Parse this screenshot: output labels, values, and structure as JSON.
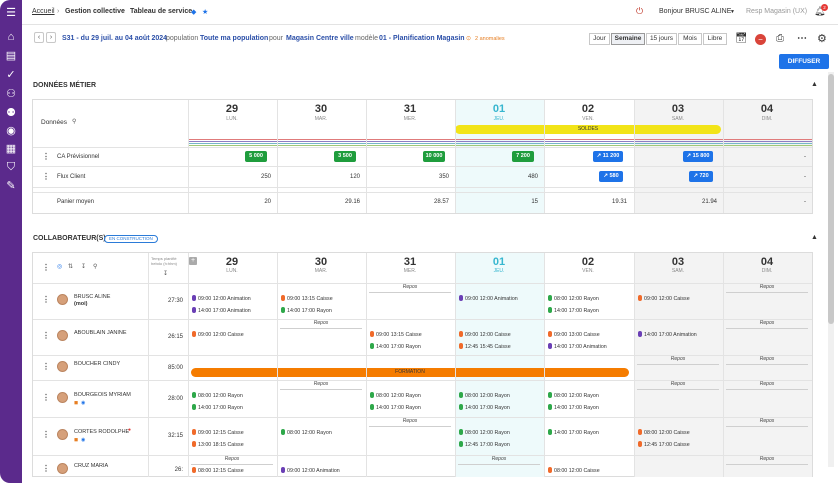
{
  "breadcrumb": {
    "home": "Accueil",
    "section": "Gestion collective",
    "current": "Tableau de service"
  },
  "header": {
    "greeting": "Bonjour BRUSC ALINE",
    "store": "Resp Magasin (UX)",
    "notif_count": "2"
  },
  "filters": {
    "period": "S31 - du 29 juil. au 04 août 2024",
    "population_label": "population",
    "population_value": "Toute ma population",
    "pour_label": "pour",
    "pour_value": "Magasin Centre ville",
    "model_label": "modèle",
    "model_value": "01 - Planification Magasin",
    "anomalies": "2 anomalies"
  },
  "views": [
    "Jour",
    "Semaine",
    "15 jours",
    "Mois",
    "Libre"
  ],
  "diffuser_label": "DIFFUSER",
  "business_section": {
    "title": "DONNÉES MÉTIER",
    "data_label": "Données",
    "days": [
      {
        "num": "29",
        "name": "LUN."
      },
      {
        "num": "30",
        "name": "MAR."
      },
      {
        "num": "31",
        "name": "MER."
      },
      {
        "num": "01",
        "name": "JEU."
      },
      {
        "num": "02",
        "name": "VEN."
      },
      {
        "num": "03",
        "name": "SAM."
      },
      {
        "num": "04",
        "name": "DIM."
      }
    ],
    "event": "SOLDES",
    "rows": [
      {
        "label": "CA Prévisionnel",
        "values": [
          "5 000",
          "3 500",
          "10 000",
          "7 200",
          "11 200",
          "15 800",
          "-"
        ]
      },
      {
        "label": "Flux Client",
        "values": [
          "250",
          "120",
          "350",
          "480",
          "580",
          "720",
          "-"
        ]
      },
      {
        "label": "Panier moyen",
        "values": [
          "20",
          "29.16",
          "28.57",
          "15",
          "19.31",
          "21.94",
          "-"
        ]
      }
    ]
  },
  "collab_section": {
    "title": "COLLABORATEUR(S)",
    "tag": "EN CONSTRUCTION",
    "time_header": "Temps planifié hebdo (h:hhm)",
    "formation": "FORMATION",
    "repos": "Repos",
    "employees": [
      {
        "name": "BRUSC ALINE",
        "sub": "(moi)",
        "hours": "27:30"
      },
      {
        "name": "ABOUBLAIN JANINE",
        "sub": "",
        "hours": "26:15"
      },
      {
        "name": "BOUCHER CINDY",
        "sub": "",
        "hours": "85:00"
      },
      {
        "name": "BOURGEOIS MYRIAM",
        "sub": "",
        "hours": "28:00"
      },
      {
        "name": "CORTES RODOLPHE",
        "sub": "",
        "hours": "32:15"
      },
      {
        "name": "CRUZ MARIA",
        "sub": "",
        "hours": "26:"
      }
    ],
    "shifts": {
      "r0": [
        [
          "09:00 12:00 Animation",
          "14:00 17:00 Animation"
        ],
        [
          "09:00 13:15 Caisse",
          "14:00 17:00 Rayon"
        ],
        [
          "09:00 12:00 Animation"
        ],
        [
          "08:00 12:00 Rayon",
          "14:00 17:00 Rayon"
        ],
        [
          "09:00 12:00 Caisse"
        ]
      ],
      "r1": [
        [
          "09:00 12:00 Caisse"
        ],
        [
          "09:00 13:15 Caisse",
          "14:00 17:00 Rayon"
        ],
        [
          "09:00 12:00 Caisse",
          "12:45 15:45 Caisse"
        ],
        [
          "09:00 13:00 Caisse",
          "14:00 17:00 Animation"
        ],
        [
          "14:00 17:00 Animation"
        ]
      ],
      "r3": [
        [
          "08:00 12:00 Rayon",
          "14:00 17:00 Rayon"
        ],
        [
          "08:00 12:00 Rayon",
          "14:00 17:00 Rayon"
        ],
        [
          "08:00 12:00 Rayon",
          "14:00 17:00 Rayon"
        ],
        [
          "08:00 12:00 Rayon",
          "14:00 17:00 Rayon"
        ]
      ],
      "r4": [
        [
          "09:00 12:15 Caisse",
          "13:00 18:15 Caisse"
        ],
        [
          "08:00 12:00 Rayon"
        ],
        [
          "08:00 12:00 Rayon",
          "12:45 17:00 Rayon"
        ],
        [
          "14:00 17:00 Rayon"
        ],
        [
          "08:00 12:00 Caisse",
          "12:45 17:00 Caisse"
        ]
      ],
      "r5": [
        [
          "08:00 12:15 Caisse"
        ],
        [
          "09:00 12:00 Animation"
        ],
        [
          "08:00 12:00 Caisse"
        ]
      ]
    }
  },
  "colors": {
    "sidebar": "#5b2a8c",
    "accent": "#1e73e8",
    "green_badge": "#1f9d3d",
    "today": "#36b6cf",
    "soldes": "#f2e418",
    "formation": "#f57c00",
    "shift_green": "#2ea84a",
    "shift_orange": "#f06a2a",
    "shift_purple": "#6a3fb5"
  }
}
